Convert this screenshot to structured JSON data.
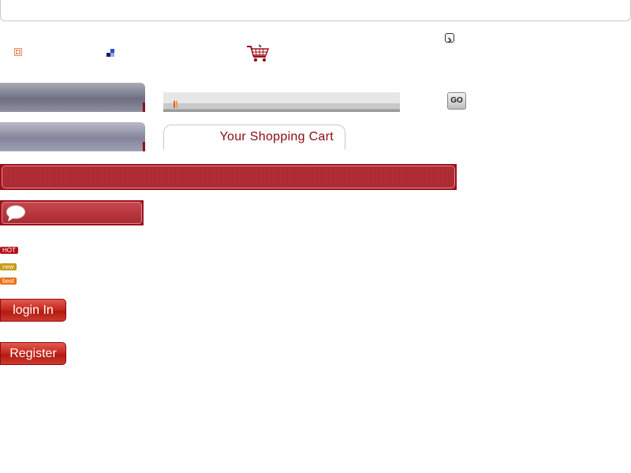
{
  "header": {
    "cart_tab_label": "Your Shopping Cart"
  },
  "search": {
    "go_label": "GO"
  },
  "badges": {
    "hot": "HOT",
    "new": "new",
    "best": "best"
  },
  "account": {
    "login_label": "login In",
    "register_label": "Register"
  },
  "icons": {
    "plus": "plus-icon",
    "blue": "square-icon",
    "cart": "shopping-cart-icon",
    "arrow": "chevron-right-icon",
    "speech": "speech-bubble-icon"
  },
  "colors": {
    "brand_red": "#9b111e",
    "accent_orange": "#ec6d12",
    "accent_gold": "#c69a12",
    "text_red": "#8b0a12"
  }
}
